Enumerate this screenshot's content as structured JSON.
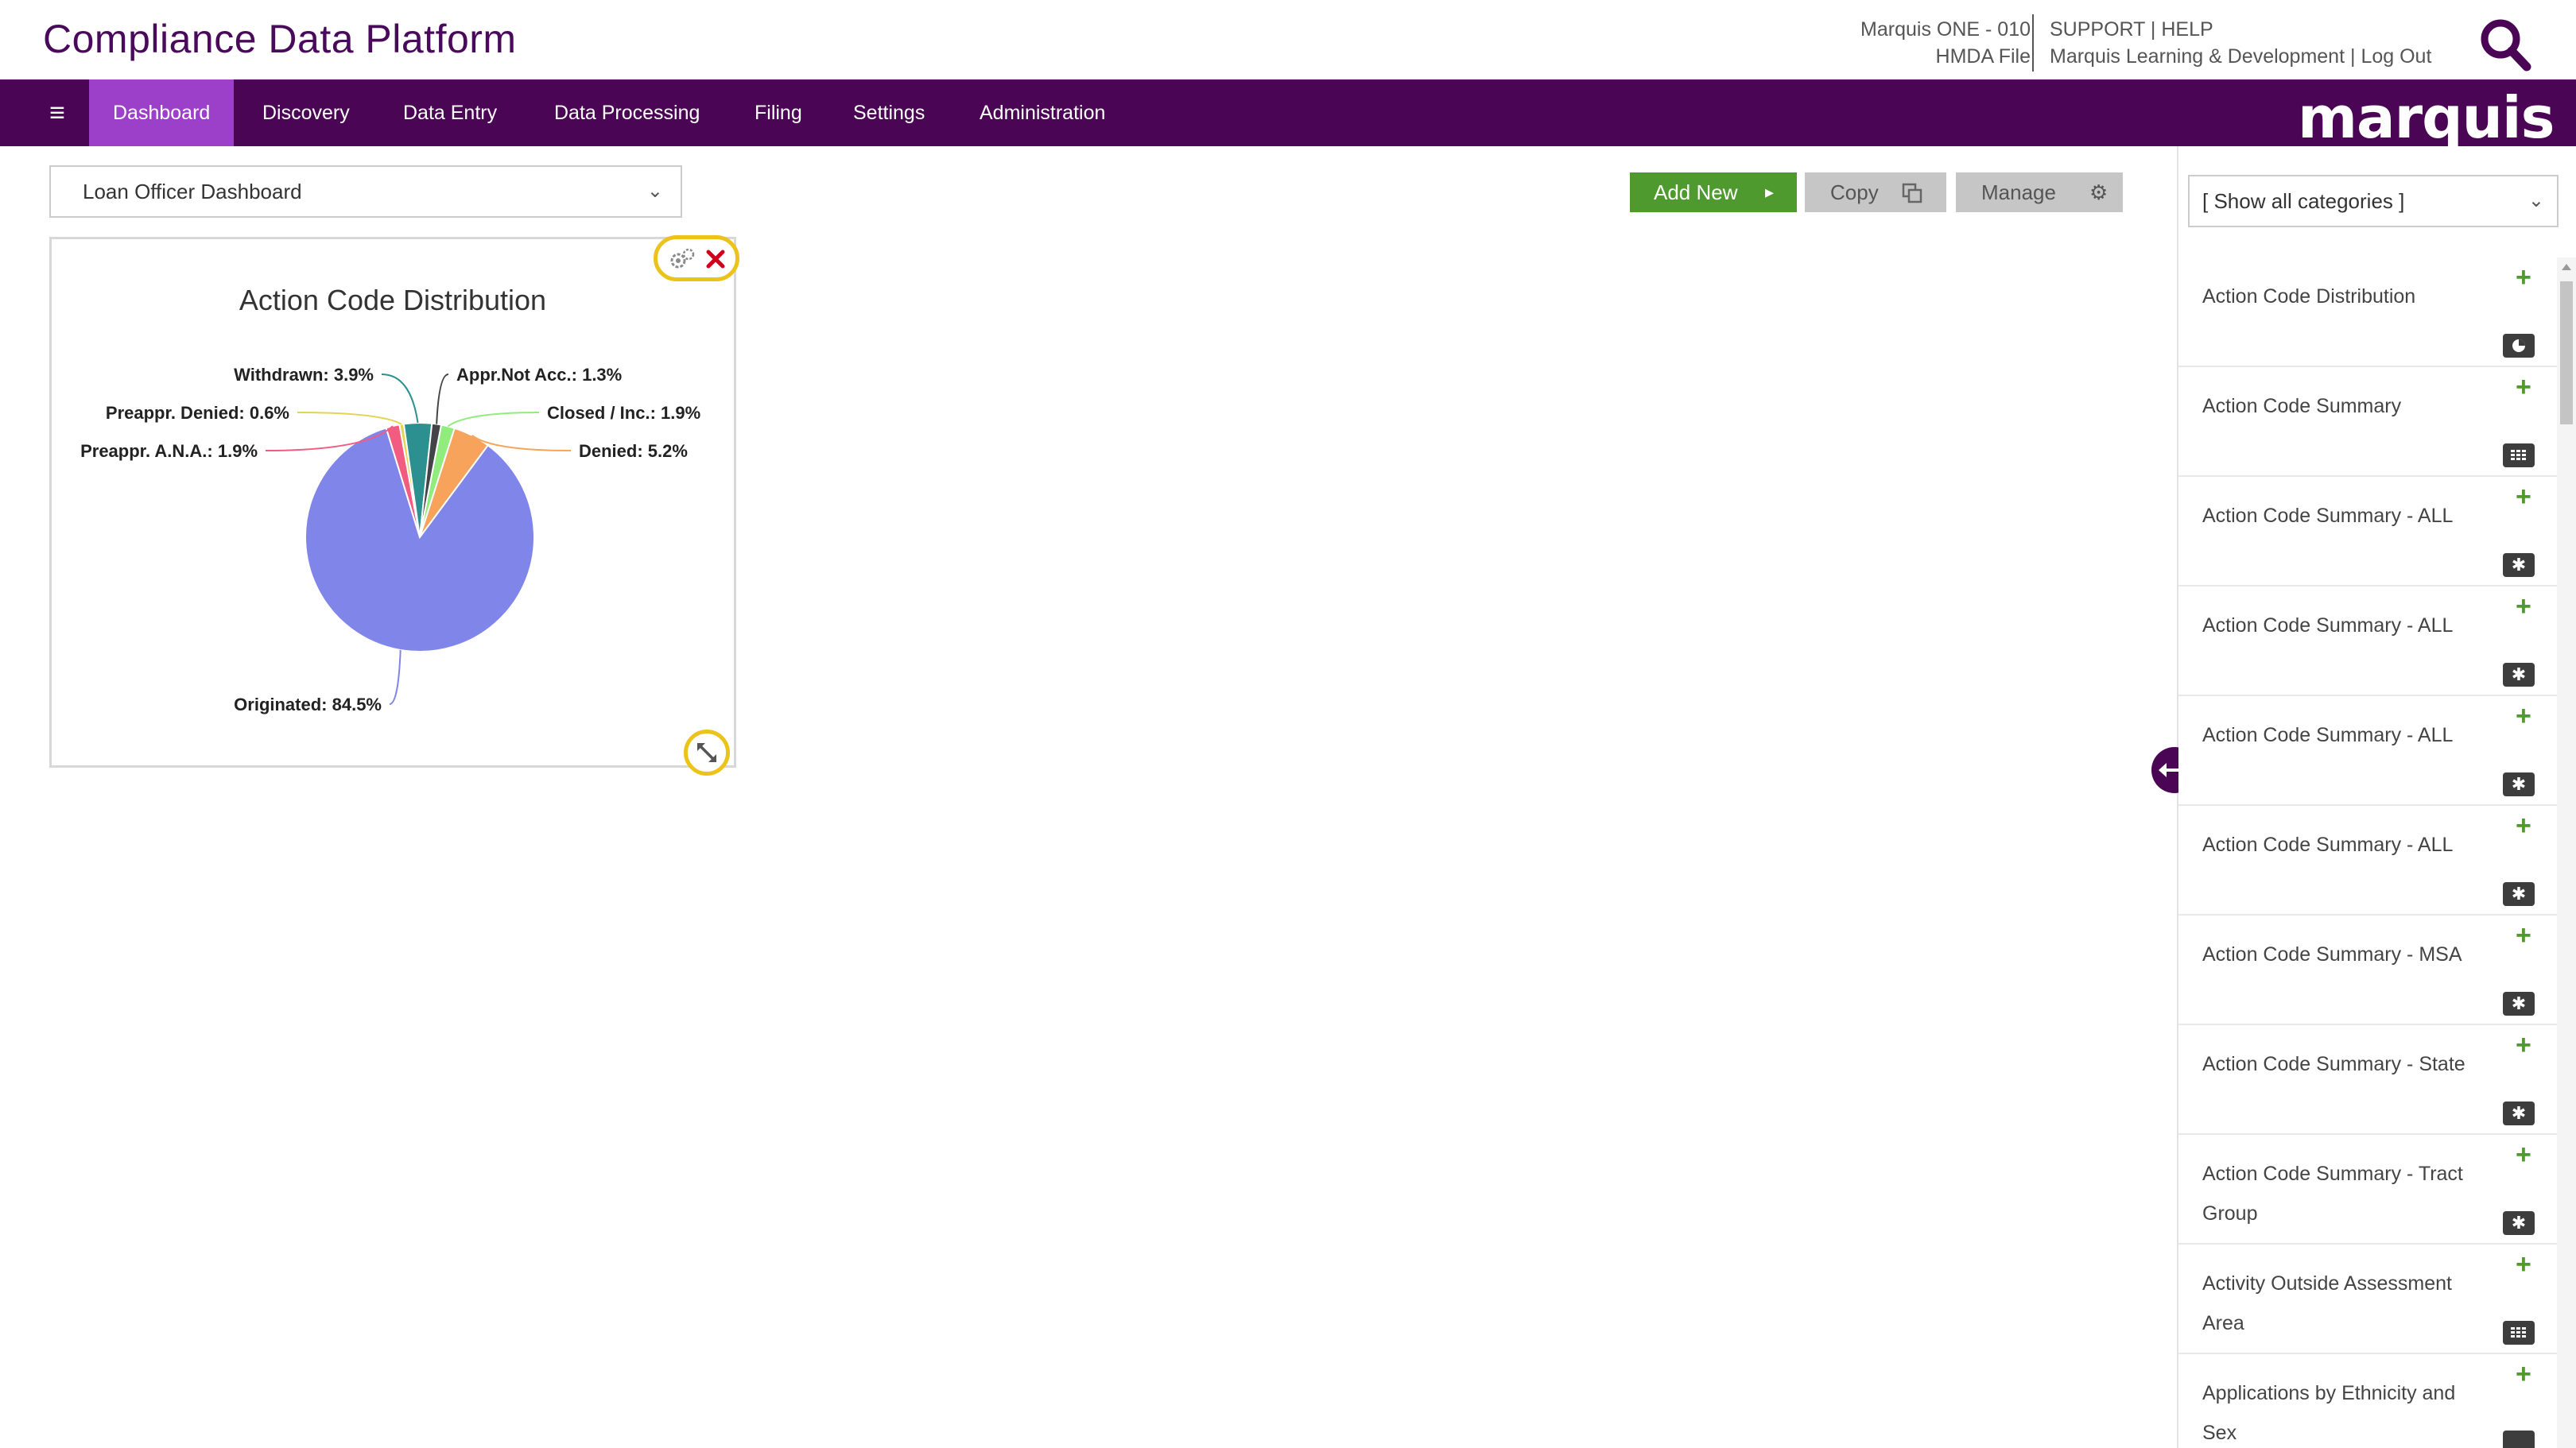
{
  "header": {
    "app_title": "Compliance Data Platform",
    "account_line1": "Marquis ONE - 010",
    "account_line2": "HMDA File",
    "support_label": "SUPPORT",
    "help_label": "HELP",
    "org_label": "Marquis Learning & Development",
    "logout_label": "Log Out",
    "separator": "|"
  },
  "nav": {
    "tabs": [
      {
        "label": "Dashboard",
        "active": true
      },
      {
        "label": "Discovery",
        "active": false
      },
      {
        "label": "Data Entry",
        "active": false
      },
      {
        "label": "Data Processing",
        "active": false
      },
      {
        "label": "Filing",
        "active": false
      },
      {
        "label": "Settings",
        "active": false
      },
      {
        "label": "Administration",
        "active": false
      }
    ],
    "brand": "marquis",
    "menu_icon": "hamburger-icon"
  },
  "toolbar": {
    "dashboard_selected": "Loan Officer Dashboard",
    "add_new_label": "Add New",
    "copy_label": "Copy",
    "manage_label": "Manage"
  },
  "widget": {
    "title": "Action Code Distribution",
    "icons": [
      "gears-icon",
      "close-icon",
      "resize-icon"
    ]
  },
  "chart_data": {
    "type": "pie",
    "title": "Action Code Distribution",
    "slices": [
      {
        "label": "Originated",
        "value": 84.5,
        "color": "#8085e9"
      },
      {
        "label": "Preappr. A.N.A.",
        "value": 1.9,
        "color": "#f15c80"
      },
      {
        "label": "Preappr. Denied",
        "value": 0.6,
        "color": "#e4d354"
      },
      {
        "label": "Withdrawn",
        "value": 3.9,
        "color": "#2b908f"
      },
      {
        "label": "Appr.Not Acc.",
        "value": 1.3,
        "color": "#434348"
      },
      {
        "label": "Closed / Inc.",
        "value": 1.9,
        "color": "#90ed7d"
      },
      {
        "label": "Denied",
        "value": 5.2,
        "color": "#f7a35c"
      }
    ],
    "data_labels": [
      {
        "text": "Withdrawn: 3.9%",
        "color": "#2b908f"
      },
      {
        "text": "Appr.Not Acc.: 1.3%",
        "color": "#434348"
      },
      {
        "text": "Preappr. Denied: 0.6%",
        "color": "#e4d354"
      },
      {
        "text": "Closed / Inc.: 1.9%",
        "color": "#90ed7d"
      },
      {
        "text": "Preappr. A.N.A.: 1.9%",
        "color": "#f15c80"
      },
      {
        "text": "Denied: 5.2%",
        "color": "#f7a35c"
      },
      {
        "text": "Originated: 84.5%",
        "color": "#8085e9"
      }
    ],
    "legend": "none"
  },
  "panel": {
    "category_selected": "[ Show all categories ]",
    "widgets": [
      {
        "label": "Action Code Distribution",
        "type_icon": "pie-chart-icon"
      },
      {
        "label": "Action Code Summary",
        "type_icon": "table-icon"
      },
      {
        "label": "Action Code Summary - ALL",
        "type_icon": "asterisk-icon"
      },
      {
        "label": "Action Code Summary - ALL",
        "type_icon": "asterisk-icon"
      },
      {
        "label": "Action Code Summary - ALL",
        "type_icon": "asterisk-icon"
      },
      {
        "label": "Action Code Summary - ALL",
        "type_icon": "asterisk-icon"
      },
      {
        "label": "Action Code Summary - MSA",
        "type_icon": "asterisk-icon"
      },
      {
        "label": "Action Code Summary - State",
        "type_icon": "asterisk-icon"
      },
      {
        "label": "Action Code Summary - Tract Group",
        "type_icon": "asterisk-icon"
      },
      {
        "label": "Activity Outside Assessment Area",
        "type_icon": "table-icon"
      },
      {
        "label": "Applications by Ethnicity and Sex",
        "type_icon": "table-icon"
      }
    ]
  },
  "colors": {
    "brand_purple": "#4a0555",
    "active_tab": "#9c3fc9",
    "add_green": "#4f9a2e",
    "highlight_yellow": "#ecc31a",
    "close_red": "#d0021b"
  }
}
